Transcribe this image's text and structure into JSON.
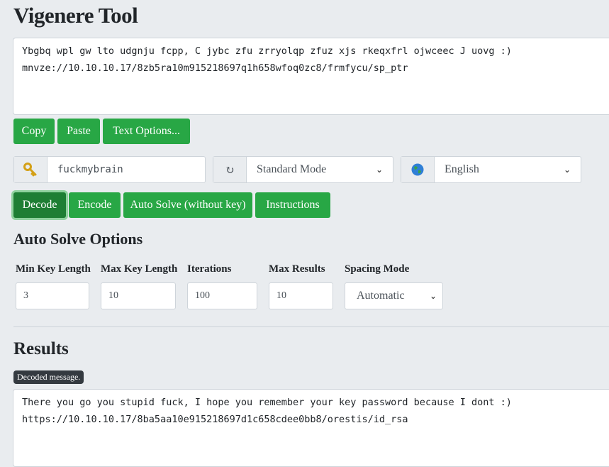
{
  "page": {
    "title": "Vigenere Tool"
  },
  "input_text": {
    "value": "Ybgbq wpl gw lto udgnju fcpp, C jybc zfu zrryolqp zfuz xjs rkeqxfrl ojwceec J uovg :)\nmnvze://10.10.10.17/8zb5ra10m915218697q1h658wfoq0zc8/frmfycu/sp_ptr"
  },
  "text_buttons": {
    "copy": "Copy",
    "paste": "Paste",
    "options": "Text Options..."
  },
  "key": {
    "icon": "key-icon",
    "value": "fuckmybrain"
  },
  "mode": {
    "icon": "refresh-icon",
    "selected": "Standard Mode"
  },
  "language": {
    "icon": "globe-icon",
    "selected": "English"
  },
  "actions": {
    "decode": "Decode",
    "encode": "Encode",
    "auto_solve": "Auto Solve (without key)",
    "instructions": "Instructions"
  },
  "auto_solve": {
    "heading": "Auto Solve Options",
    "min_key_length": {
      "label": "Min Key Length",
      "value": "3"
    },
    "max_key_length": {
      "label": "Max Key Length",
      "value": "10"
    },
    "iterations": {
      "label": "Iterations",
      "value": "100"
    },
    "max_results": {
      "label": "Max Results",
      "value": "10"
    },
    "spacing_mode": {
      "label": "Spacing Mode",
      "selected": "Automatic"
    }
  },
  "results": {
    "heading": "Results",
    "badge": "Decoded message.",
    "output": "There you go you stupid fuck, I hope you remember your key password because I dont :)\nhttps://10.10.10.17/8ba5aa10e915218697d1c658cdee0bb8/orestis/id_rsa"
  },
  "colors": {
    "primary": "#28a745",
    "primary_active": "#1e7e34",
    "background": "#e9ecef"
  }
}
